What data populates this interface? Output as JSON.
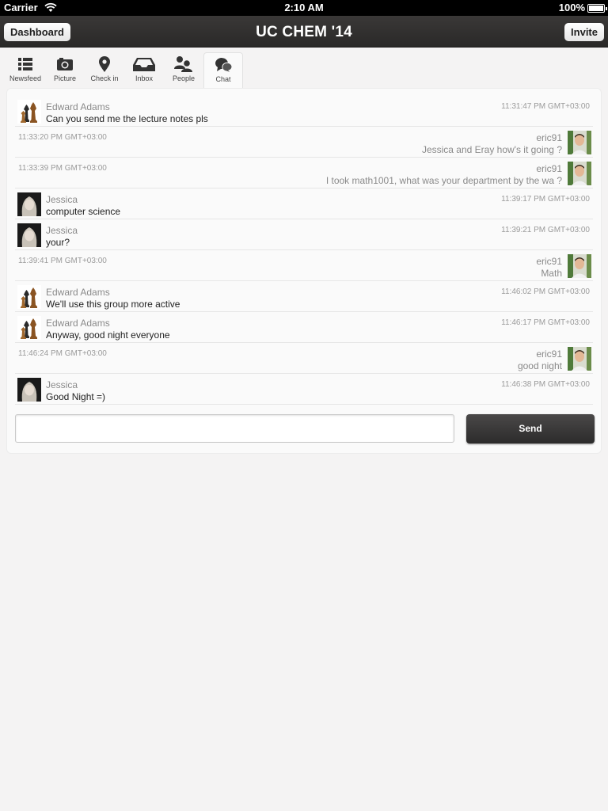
{
  "status_bar": {
    "carrier": "Carrier",
    "time": "2:10 AM",
    "battery": "100%"
  },
  "nav": {
    "left_button": "Dashboard",
    "title": "UC CHEM '14",
    "right_button": "Invite"
  },
  "tabs": [
    {
      "label": "Newsfeed",
      "icon": "list-icon"
    },
    {
      "label": "Picture",
      "icon": "camera-icon"
    },
    {
      "label": "Check in",
      "icon": "map-pin-icon"
    },
    {
      "label": "Inbox",
      "icon": "inbox-tray-icon"
    },
    {
      "label": "People",
      "icon": "people-icon"
    },
    {
      "label": "Chat",
      "icon": "chat-bubbles-icon",
      "active": true
    }
  ],
  "messages": [
    {
      "direction": "in",
      "sender": "Edward Adams",
      "avatar": "chess-pieces-avatar",
      "text": "Can you send me the lecture notes pls",
      "time": "11:31:47 PM GMT+03:00"
    },
    {
      "direction": "out",
      "sender": "eric91",
      "avatar": "eric-photo-avatar",
      "text": "Jessica and Eray how's it going ?",
      "time": "11:33:20 PM GMT+03:00"
    },
    {
      "direction": "out",
      "sender": "eric91",
      "avatar": "eric-photo-avatar",
      "text": "I took math1001, what was your department by the wa ?",
      "time": "11:33:39 PM GMT+03:00"
    },
    {
      "direction": "in",
      "sender": "Jessica",
      "avatar": "jessica-photo-avatar",
      "text": "computer science",
      "time": "11:39:17 PM GMT+03:00"
    },
    {
      "direction": "in",
      "sender": "Jessica",
      "avatar": "jessica-photo-avatar",
      "text": "your?",
      "time": "11:39:21 PM GMT+03:00"
    },
    {
      "direction": "out",
      "sender": "eric91",
      "avatar": "eric-photo-avatar",
      "text": "Math",
      "time": "11:39:41 PM GMT+03:00"
    },
    {
      "direction": "in",
      "sender": "Edward Adams",
      "avatar": "chess-pieces-avatar",
      "text": "We'll use this group more active",
      "time": "11:46:02 PM GMT+03:00"
    },
    {
      "direction": "in",
      "sender": "Edward Adams",
      "avatar": "chess-pieces-avatar",
      "text": "Anyway, good night everyone",
      "time": "11:46:17 PM GMT+03:00"
    },
    {
      "direction": "out",
      "sender": "eric91",
      "avatar": "eric-photo-avatar",
      "text": "good night",
      "time": "11:46:24 PM GMT+03:00"
    },
    {
      "direction": "in",
      "sender": "Jessica",
      "avatar": "jessica-photo-avatar",
      "text": "Good Night =)",
      "time": "11:46:38 PM GMT+03:00"
    }
  ],
  "composer": {
    "value": "",
    "placeholder": "",
    "send_label": "Send"
  },
  "colors": {
    "nav_bar": "#2f2e2d",
    "background": "#f4f3f3",
    "panel": "#fafafa",
    "send_button": "#333232",
    "muted_text": "#8a8a8a"
  }
}
